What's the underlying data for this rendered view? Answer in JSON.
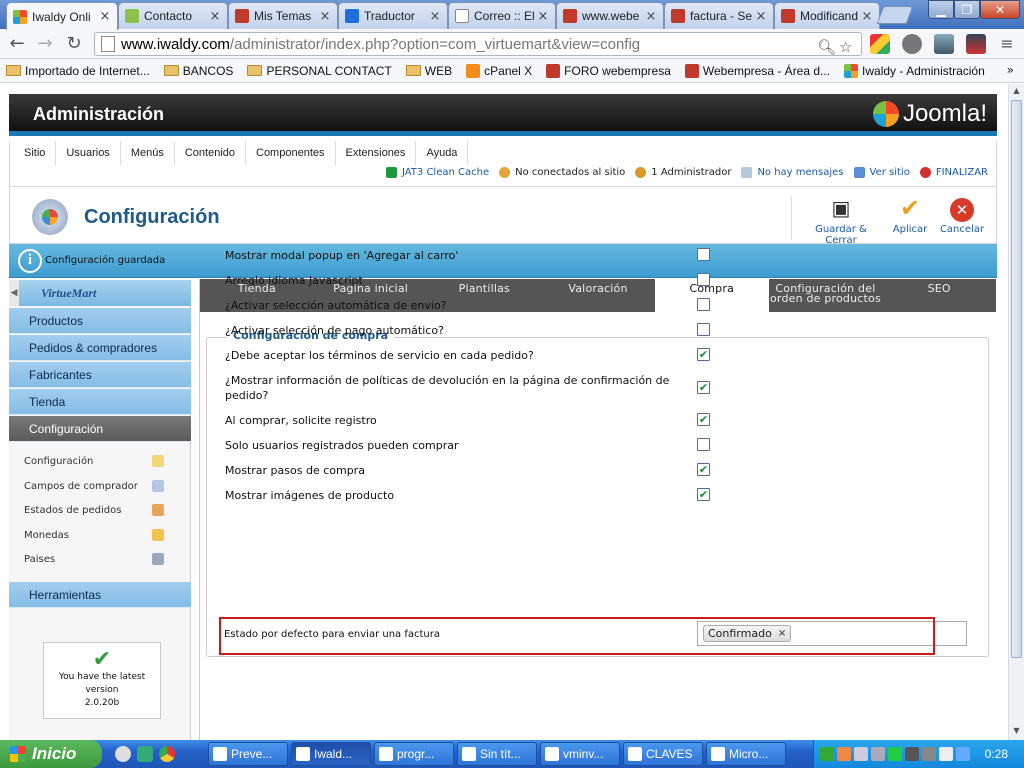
{
  "browser": {
    "tabs": [
      {
        "title": "Iwaldy Onli",
        "active": true,
        "icon": "joomla-icon"
      },
      {
        "title": "Contacto",
        "active": false,
        "icon": "u-site-icon"
      },
      {
        "title": "Mis Temas",
        "active": false,
        "icon": "webempresa-icon"
      },
      {
        "title": "Traductor",
        "active": false,
        "icon": "translate-icon"
      },
      {
        "title": "Correo :: El",
        "active": false,
        "icon": "page-icon"
      },
      {
        "title": "www.webe",
        "active": false,
        "icon": "webempresa-icon"
      },
      {
        "title": "factura - Se",
        "active": false,
        "icon": "webempresa-icon"
      },
      {
        "title": "Modificand",
        "active": false,
        "icon": "webempresa-icon"
      }
    ],
    "url_host": "www.iwaldy.com",
    "url_path": "/administrator/index.php?option=com_virtuemart&view=config",
    "bookmarks": [
      {
        "label": "Importado de Internet...",
        "kind": "folder"
      },
      {
        "label": "BANCOS",
        "kind": "folder"
      },
      {
        "label": "PERSONAL CONTACT",
        "kind": "folder"
      },
      {
        "label": "WEB",
        "kind": "folder"
      },
      {
        "label": "cPanel X",
        "kind": "cpanel"
      },
      {
        "label": "FORO webempresa",
        "kind": "webempresa"
      },
      {
        "label": "Webempresa - Área d...",
        "kind": "webempresa"
      },
      {
        "label": "Iwaldy - Administración",
        "kind": "joomla"
      }
    ],
    "more_bookmarks": "»"
  },
  "admin": {
    "header_title": "Administración",
    "logo_text": "Joomla!",
    "menu": [
      "Sitio",
      "Usuarios",
      "Menús",
      "Contenido",
      "Componentes",
      "Extensiones",
      "Ayuda"
    ],
    "status": {
      "cache": "JAT3 Clean Cache",
      "connected": "No conectados al sitio",
      "admins": "1 Administrador",
      "messages": "No hay mensajes",
      "view_site": "Ver sitio",
      "logout": "FINALIZAR"
    },
    "page_title": "Configuración",
    "toolbar": {
      "save_close": "Guardar & Cerrar",
      "apply": "Aplicar",
      "cancel": "Cancelar"
    },
    "message": "Configuración guardada"
  },
  "sidebar": {
    "brand": "VirtueMart",
    "nav": [
      "Productos",
      "Pedidos & compradores",
      "Fabricantes",
      "Tienda",
      "Configuración"
    ],
    "active_nav": "Configuración",
    "sub": [
      "Configuración",
      "Campos de comprador",
      "Estados de pedidos",
      "Monedas",
      "Paises"
    ],
    "tools": "Herramientas",
    "version_text": "You have the latest version",
    "version_number": "2.0.20b"
  },
  "main": {
    "tabs": [
      "Tienda",
      "Pagina inicial",
      "Plantillas",
      "Valoración",
      "Compra",
      "Configuración del orden de productos",
      "SEO"
    ],
    "active_tab": "Compra",
    "legend": "Configuración de compra",
    "options": [
      {
        "label": "Mostrar modal popup en 'Agregar al carro'",
        "checked": false
      },
      {
        "label": "Arreglo idioma Javascript",
        "checked": false
      },
      {
        "label": "¿Activar selección automática de envío?",
        "checked": false
      },
      {
        "label": "¿Activar selección de pago automático?",
        "checked": false
      },
      {
        "label": "¿Debe aceptar los términos de servicio en cada pedido?",
        "checked": true
      },
      {
        "label": "¿Mostrar información de políticas de devolución en la página de confirmación de pedido?",
        "checked": true
      },
      {
        "label": "Al comprar, solicite registro",
        "checked": true
      },
      {
        "label": "Solo usuarios registrados pueden comprar",
        "checked": false
      },
      {
        "label": "Mostrar pasos de compra",
        "checked": true
      },
      {
        "label": "Mostrar imágenes de producto",
        "checked": true
      }
    ],
    "invoice_label": "Estado por defecto para enviar una factura",
    "invoice_value": "Confirmado",
    "invoice_remove": "×"
  },
  "taskbar": {
    "start": "Inicio",
    "items": [
      "Preve...",
      "Iwald...",
      "progr...",
      "Sin tít...",
      "vminv...",
      "CLAVES",
      "Micro..."
    ],
    "active_item": "Iwald...",
    "clock": "0:28"
  },
  "colors": {
    "accent_blue": "#1e5a8c",
    "message_bar": "#3e9cd0",
    "highlight_red": "#c81d1d",
    "checkbox_green": "#1c8c34"
  }
}
